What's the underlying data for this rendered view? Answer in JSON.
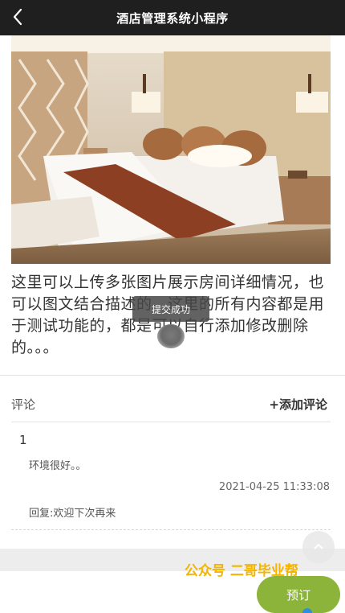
{
  "navbar": {
    "title": "酒店管理系统小程序",
    "back_icon": "back-arrow-icon"
  },
  "room": {
    "description": "这里可以上传多张图片展示房间详细情况，也可以图文结合描述的。这里的所有内容都是用于测试功能的，都是可以自行添加修改删除的。。。"
  },
  "toast": {
    "text": "提交成功"
  },
  "comments": {
    "label": "评论",
    "add_label": "+添加评论",
    "items": [
      {
        "user": "1",
        "content": "环境很好。。",
        "time": "2021-04-25 11:33:08",
        "reply": "回复:欢迎下次再来"
      }
    ]
  },
  "watermark": "公众号 二哥毕业帮",
  "book_button": "预订",
  "colors": {
    "navbar": "#1f1f1f",
    "book_button": "#8cb43a",
    "watermark": "#f4b400"
  }
}
